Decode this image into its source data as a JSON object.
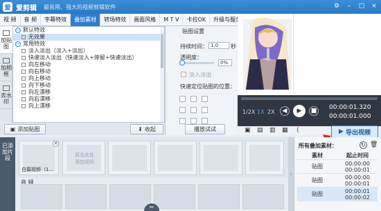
{
  "app": {
    "title": "爱剪辑",
    "slogan": "最易用、强大的视频剪辑软件"
  },
  "tabs": [
    "视 频",
    "音 频",
    "字幕特效",
    "叠加素材",
    "转场特效",
    "画面风格",
    "M T V",
    "卡拉OK",
    "升级与服务"
  ],
  "active_tab": "叠加素材",
  "leftnav": [
    "加贴图",
    "加相框",
    "去水印"
  ],
  "effects": {
    "groups": [
      {
        "label": "默认特效",
        "items": [
          "无效果"
        ]
      },
      {
        "label": "常用特效",
        "items": [
          "淡入淡出（淡入+淡出）",
          "快速淡入淡出（快速淡入+停留+快速淡出）",
          "向左移动",
          "向右移动",
          "向上移动",
          "向下移动",
          "向左漂移",
          "向右漂移",
          "向上漂移"
        ]
      }
    ],
    "selected": "无效果"
  },
  "buttons": {
    "add_sticker": "添加贴图",
    "collect": "收起",
    "preview_trial": "播放试试",
    "export": "导出视频"
  },
  "settings": {
    "title": "贴图设置",
    "duration_label": "持续时间：",
    "duration_value": "1.0",
    "seconds_unit": "秒",
    "opacity_label": "透明度：",
    "opacity_value": "0%",
    "fade_label": "淡入淡出",
    "position_label": "快速定位贴图的位置："
  },
  "player": {
    "speed": [
      "1/2X",
      "1X",
      "2X"
    ],
    "current_time": "00:00:01.320",
    "total_time": "00:00:01.000"
  },
  "timeline": {
    "label": "已添加片段",
    "clip_label": "白篇视频（1...",
    "placeholder": "双击此处添加视频",
    "audio_label": "音 频"
  },
  "materials": {
    "header": "所有叠加素材：",
    "columns": [
      "素材",
      "起止时间"
    ],
    "rows": [
      {
        "name": "贴图",
        "start": "00:00:00",
        "end": "00:00:01"
      },
      {
        "name": "贴图",
        "start": "00:00:00",
        "end": "00:00:01"
      },
      {
        "name": "贴图",
        "start": "00:00:01",
        "end": "00:00:02"
      }
    ]
  },
  "colors": {
    "accent": "#2d7fd1",
    "export_bg": "#dbeaf8",
    "arrow": "#e52121"
  }
}
